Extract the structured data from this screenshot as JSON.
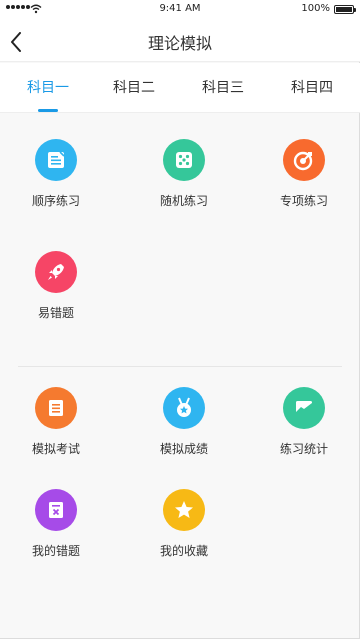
{
  "status_bar": {
    "time": "9:41 AM",
    "battery": "100%",
    "battery_level": 1.0
  },
  "nav": {
    "title": "理论模拟",
    "back_icon": "chevron-left-icon"
  },
  "tabs": [
    {
      "label": "科目一",
      "active": true
    },
    {
      "label": "科目二",
      "active": false
    },
    {
      "label": "科目三",
      "active": false
    },
    {
      "label": "科目四",
      "active": false
    }
  ],
  "practice": {
    "items": [
      {
        "label": "顺序练习",
        "icon": "notebook-icon",
        "color": "#2fb5f0"
      },
      {
        "label": "随机练习",
        "icon": "dice-icon",
        "color": "#35c79a"
      },
      {
        "label": "专项练习",
        "icon": "target-icon",
        "color": "#f86a2e"
      },
      {
        "label": "易错题",
        "icon": "rocket-icon",
        "color": "#f64566"
      }
    ]
  },
  "exam": {
    "items": [
      {
        "label": "模拟考试",
        "icon": "exam-paper-icon",
        "color": "#f57a2f"
      },
      {
        "label": "模拟成绩",
        "icon": "medal-icon",
        "color": "#2fb5f0"
      },
      {
        "label": "练习统计",
        "icon": "chart-icon",
        "color": "#35c79a"
      },
      {
        "label": "我的错题",
        "icon": "error-book-icon",
        "color": "#a64be8"
      },
      {
        "label": "我的收藏",
        "icon": "star-icon",
        "color": "#f7b915"
      }
    ]
  }
}
